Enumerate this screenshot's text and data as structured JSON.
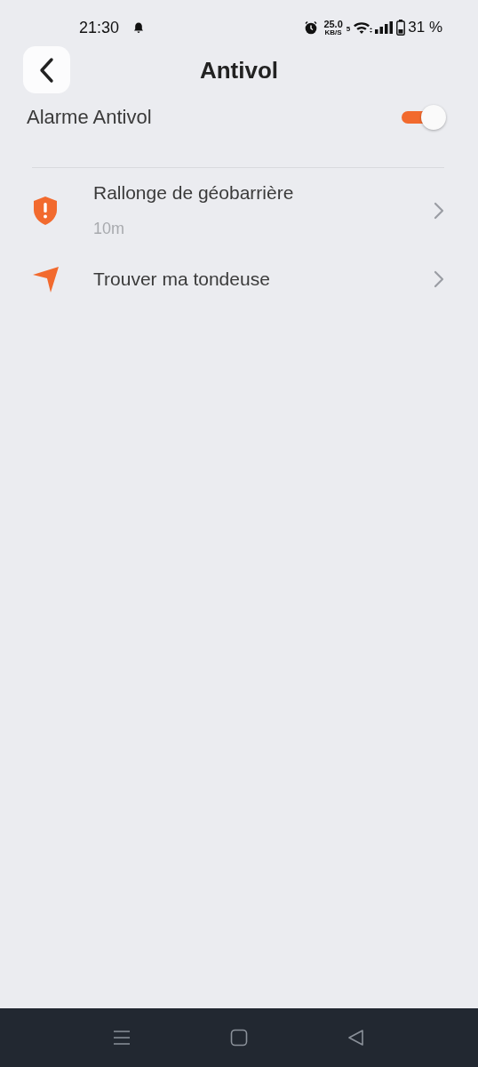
{
  "status_bar": {
    "time": "21:30",
    "net_speed": "25.0",
    "net_unit": "KB/S",
    "wifi_badge": "5",
    "battery": "31 %"
  },
  "header": {
    "title": "Antivol"
  },
  "alarm": {
    "label": "Alarme Antivol",
    "on": true
  },
  "items": [
    {
      "kind": "shield",
      "title": "Rallonge de géobarrière",
      "value": "10m"
    },
    {
      "kind": "locate",
      "title": "Trouver ma tondeuse"
    }
  ]
}
